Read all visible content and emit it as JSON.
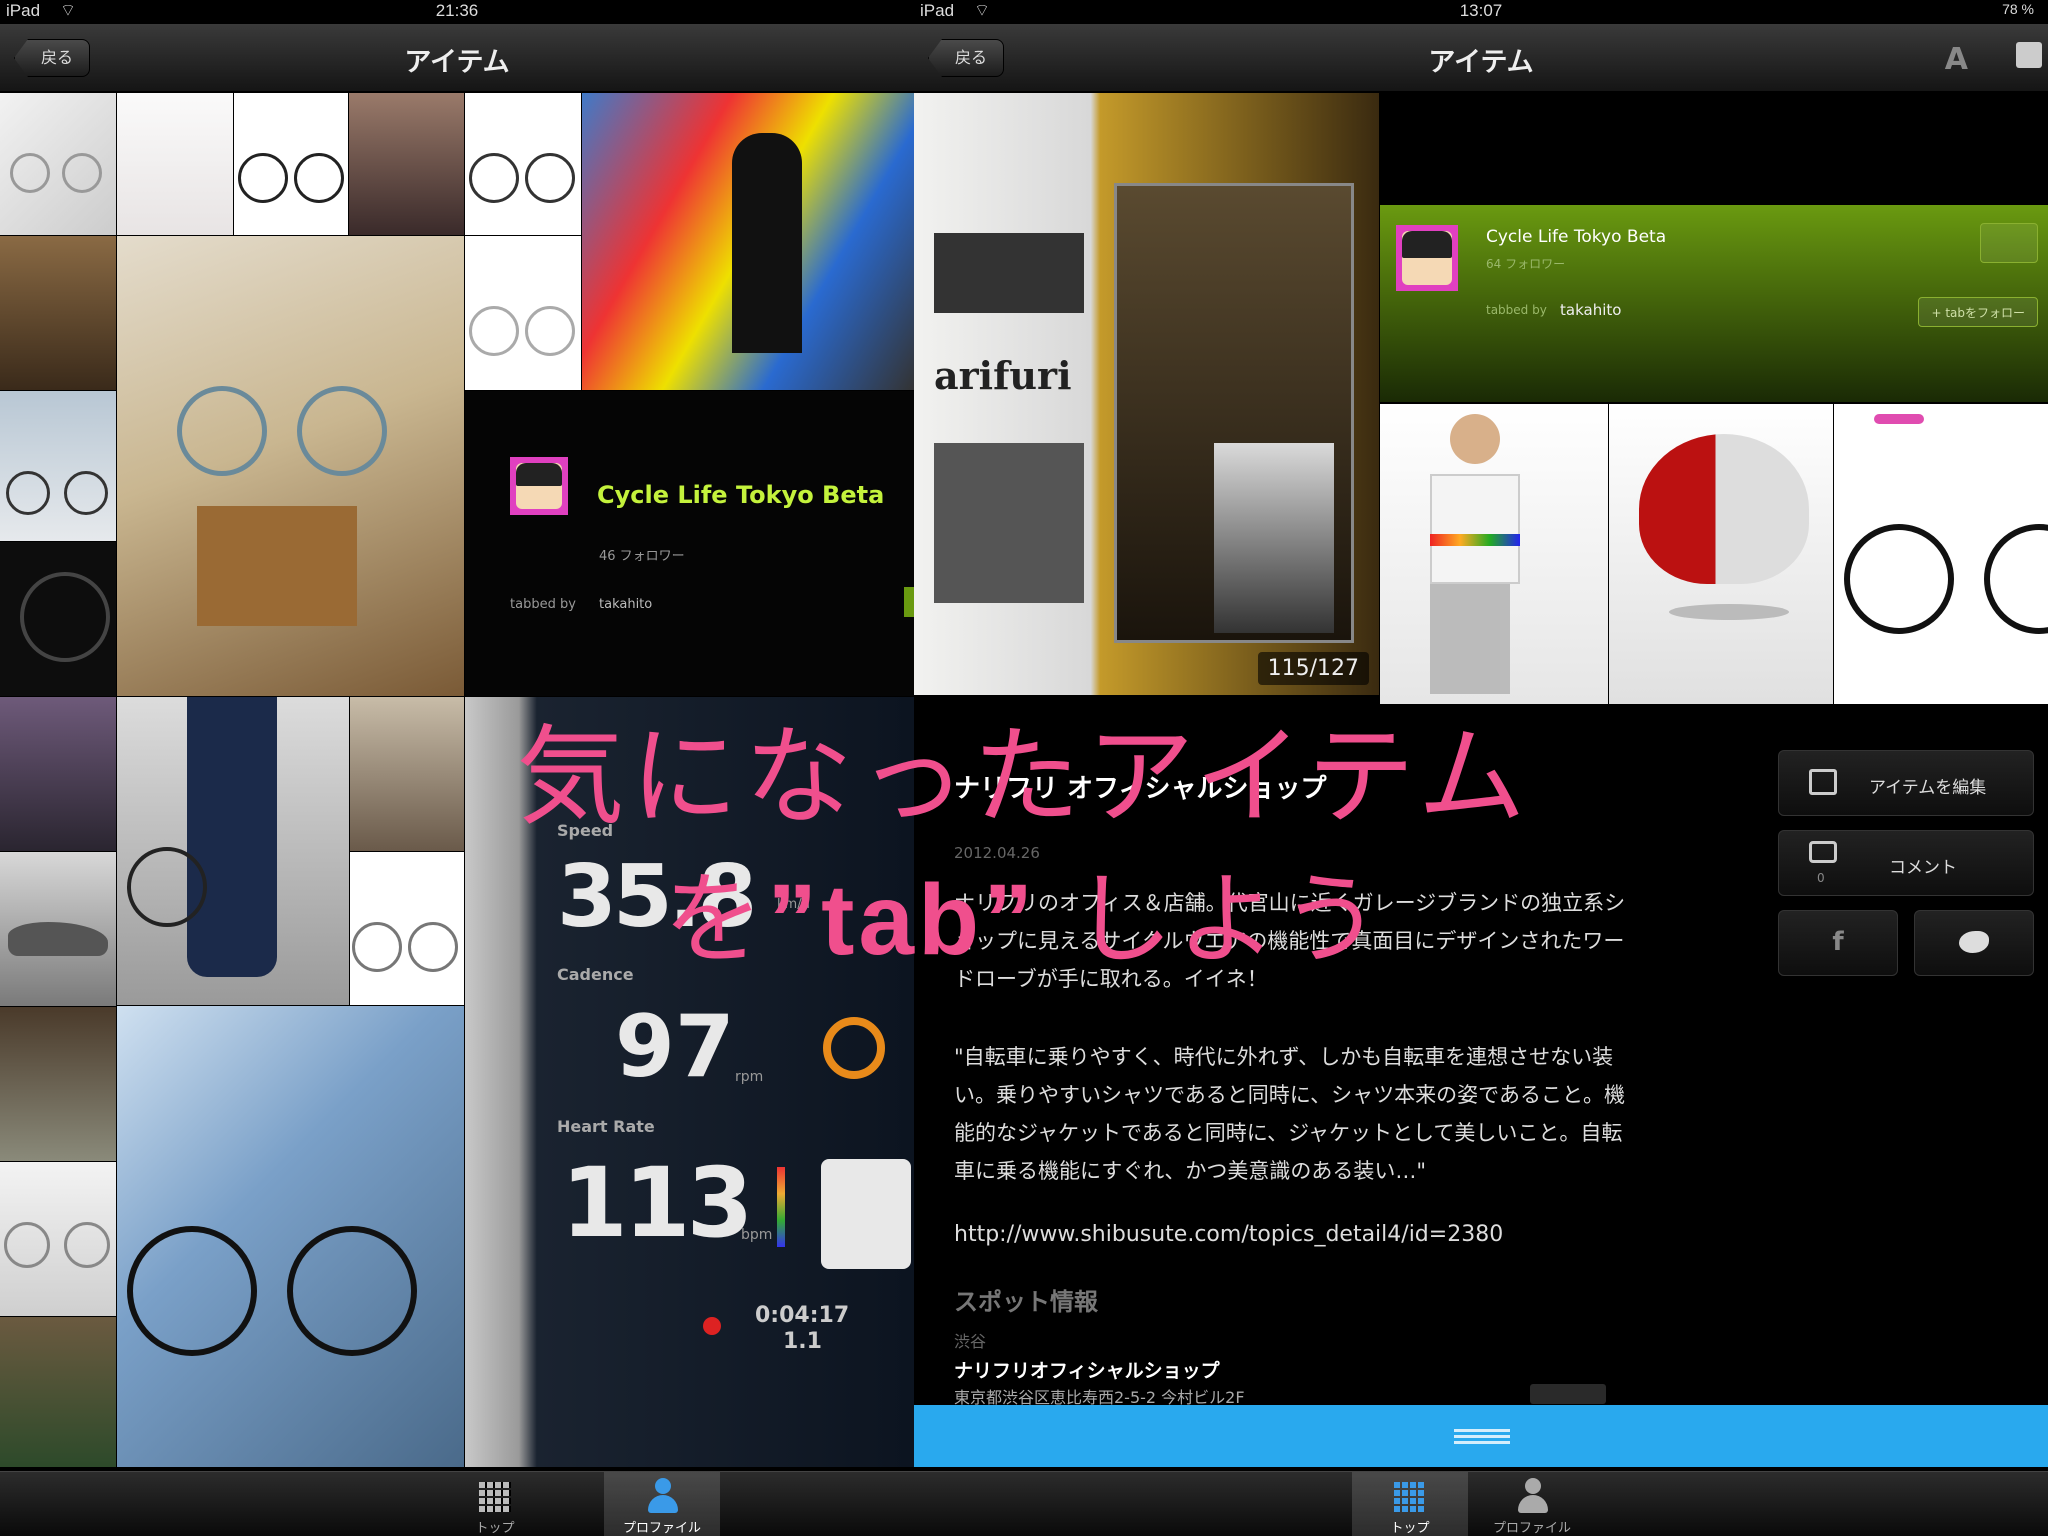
{
  "left": {
    "status": {
      "device": "iPad",
      "time": "21:36"
    },
    "nav": {
      "back": "戻る",
      "title": "アイテム"
    },
    "card": {
      "name": "Cycle Life Tokyo Beta",
      "followers": "46 フォロワー",
      "tabbed_by": "tabbed by",
      "user": "takahito"
    },
    "app": {
      "speed_label": "Speed",
      "speed": "35.8",
      "speed_unit": "km/h",
      "cadence_label": "Cadence",
      "cadence": "97",
      "cadence_unit": "rpm",
      "hr_label": "Heart Rate",
      "hr": "113",
      "hr_unit": "bpm",
      "timer": "0:04:17",
      "dist": "1.1"
    },
    "tabs": [
      "トップ",
      "プロファイル"
    ]
  },
  "right": {
    "status": {
      "device": "iPad",
      "time": "13:07",
      "battery": "78 %"
    },
    "nav": {
      "back": "戻る",
      "title": "アイテム",
      "font_btn": "A"
    },
    "counter": "115/127",
    "card": {
      "name": "Cycle Life Tokyo Beta",
      "followers": "64 フォロワー",
      "tabbed_by": "tabbed by",
      "user": "takahito",
      "follow": "+ tabをフォロー"
    },
    "item": {
      "title": "ナリフリ オフィシャルショップ",
      "date": "2012.04.26",
      "desc": "ナリフリのオフィス＆店舗。代官山に近くガレージブランドの独立系ショップに見えるサイクルウエアの機能性で真面目にデザインされたワードローブが手に取れる。イイネ！",
      "quote": "\"自転車に乗りやすく、時代に外れず、しかも自転車を連想させない装い。乗りやすいシャツであると同時に、シャツ本来の姿であること。機能的なジャケットであると同時に、ジャケットとして美しいこと。自転車に乗る機能にすぐれ、かつ美意識のある装い…\"",
      "url": "http://www.shibusute.com/topics_detail4/id=2380",
      "spot_heading": "スポット情報",
      "area": "渋谷",
      "spot_name": "ナリフリオフィシャルショップ",
      "address": "東京都渋谷区恵比寿西2-5-2 今村ビル2F"
    },
    "actions": {
      "edit": "アイテムを編集",
      "comment": "コメント",
      "comment_count": "0",
      "facebook": "f"
    },
    "tabs": [
      "トップ",
      "プロファイル"
    ]
  },
  "overlay": {
    "line1": "気になったアイテム",
    "line2_pre": "を",
    "line2_bold": "”tab”",
    "line2_post": "しよう"
  },
  "colors": {
    "overlay": "#f04f8d",
    "card_green": "#6a9a10",
    "name_green": "#c4f23c",
    "blue_bar": "#29a9ee"
  }
}
